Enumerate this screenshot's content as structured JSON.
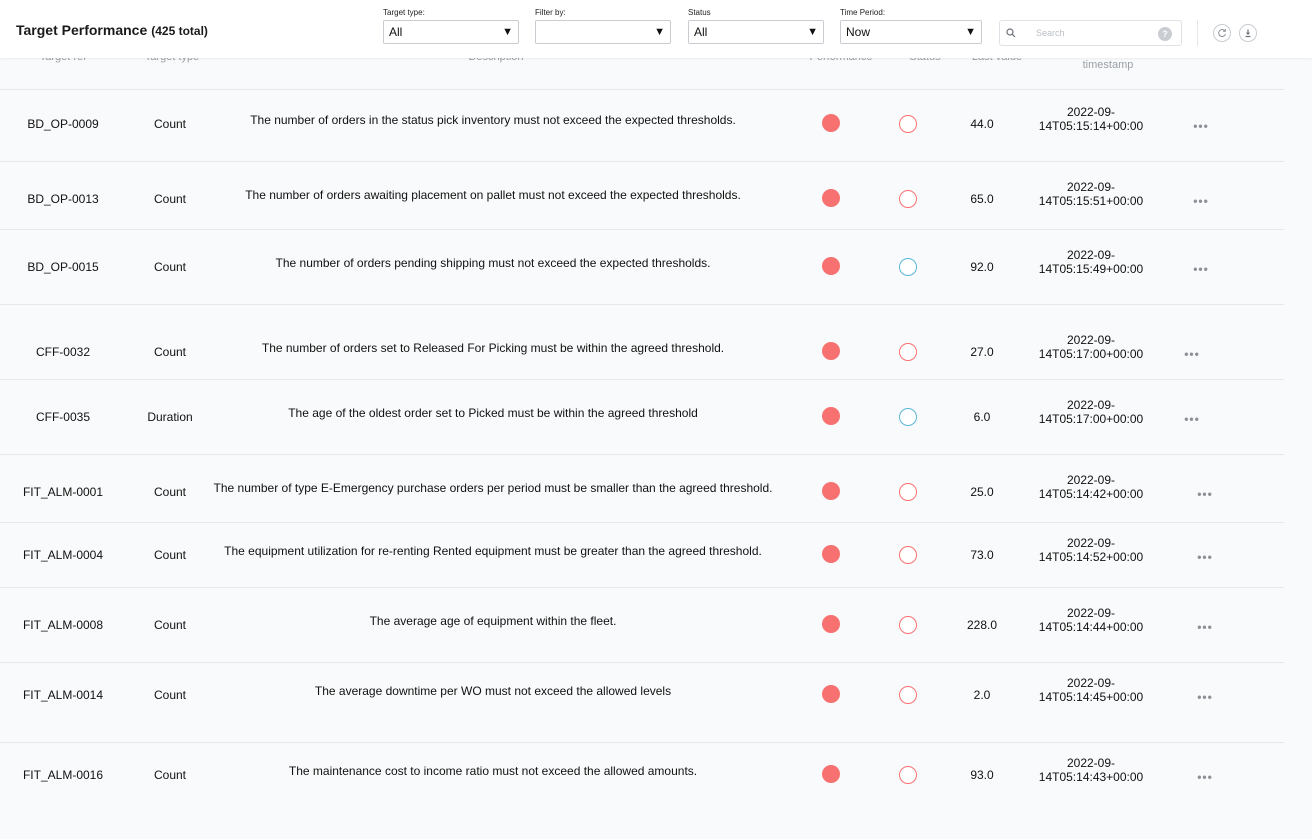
{
  "header": {
    "title": "Target Performance",
    "total": "(425 total)",
    "filters": [
      {
        "label": "Target type:",
        "value": "All"
      },
      {
        "label": "Filter by:",
        "value": ""
      },
      {
        "label": "Status",
        "value": "All"
      },
      {
        "label": "Time Period:",
        "value": "Now"
      }
    ],
    "search_placeholder": "Search",
    "help_glyph": "?"
  },
  "columns": {
    "ref": "Target ref",
    "type": "Target type",
    "description": "Description",
    "performance": "Performance",
    "status": "Status",
    "last_value": "Last value",
    "timestamp": "timestamp"
  },
  "colors": {
    "performance_red": "#f87171",
    "status_red": "#f87171",
    "status_blue": "#5ab6d9"
  },
  "rows": [
    {
      "ref": "BD_OP-0009",
      "type": "Count",
      "description": "The number of orders in the status pick inventory must not exceed the expected thresholds.",
      "status": "red",
      "last_value": "44.0",
      "ts1": "2022-09-",
      "ts2": "14T05:15:14+00:00"
    },
    {
      "ref": "BD_OP-0013",
      "type": "Count",
      "description": "The number of orders awaiting placement on pallet must not exceed the expected thresholds.",
      "status": "red",
      "last_value": "65.0",
      "ts1": "2022-09-",
      "ts2": "14T05:15:51+00:00"
    },
    {
      "ref": "BD_OP-0015",
      "type": "Count",
      "description": "The number of orders pending shipping must not exceed the expected thresholds.",
      "status": "blue",
      "last_value": "92.0",
      "ts1": "2022-09-",
      "ts2": "14T05:15:49+00:00"
    },
    {
      "ref": "CFF-0032",
      "type": "Count",
      "description": "The number of orders set to Released For Picking must be within the agreed threshold.",
      "status": "red",
      "last_value": "27.0",
      "ts1": "2022-09-",
      "ts2": "14T05:17:00+00:00"
    },
    {
      "ref": "CFF-0035",
      "type": "Duration",
      "description": "The age of the oldest order set to Picked must be within the agreed threshold",
      "status": "blue",
      "last_value": "6.0",
      "ts1": "2022-09-",
      "ts2": "14T05:17:00+00:00"
    },
    {
      "ref": "FIT_ALM-0001",
      "type": "Count",
      "description": "The number of type E-Emergency purchase orders per period must be smaller than the agreed threshold.",
      "status": "red",
      "last_value": "25.0",
      "ts1": "2022-09-",
      "ts2": "14T05:14:42+00:00"
    },
    {
      "ref": "FIT_ALM-0004",
      "type": "Count",
      "description": "The equipment utilization for re-renting Rented equipment must be greater than the agreed threshold.",
      "status": "red",
      "last_value": "73.0",
      "ts1": "2022-09-",
      "ts2": "14T05:14:52+00:00"
    },
    {
      "ref": "FIT_ALM-0008",
      "type": "Count",
      "description": "The average age of equipment within the fleet.",
      "status": "red",
      "last_value": "228.0",
      "ts1": "2022-09-",
      "ts2": "14T05:14:44+00:00"
    },
    {
      "ref": "FIT_ALM-0014",
      "type": "Count",
      "description": "The average downtime per WO must not exceed the allowed levels",
      "status": "red",
      "last_value": "2.0",
      "ts1": "2022-09-",
      "ts2": "14T05:14:45+00:00"
    },
    {
      "ref": "FIT_ALM-0016",
      "type": "Count",
      "description": "The maintenance cost to income ratio must not exceed the allowed amounts.",
      "status": "red",
      "last_value": "93.0",
      "ts1": "2022-09-",
      "ts2": "14T05:14:43+00:00"
    }
  ],
  "more_glyph": "•••"
}
